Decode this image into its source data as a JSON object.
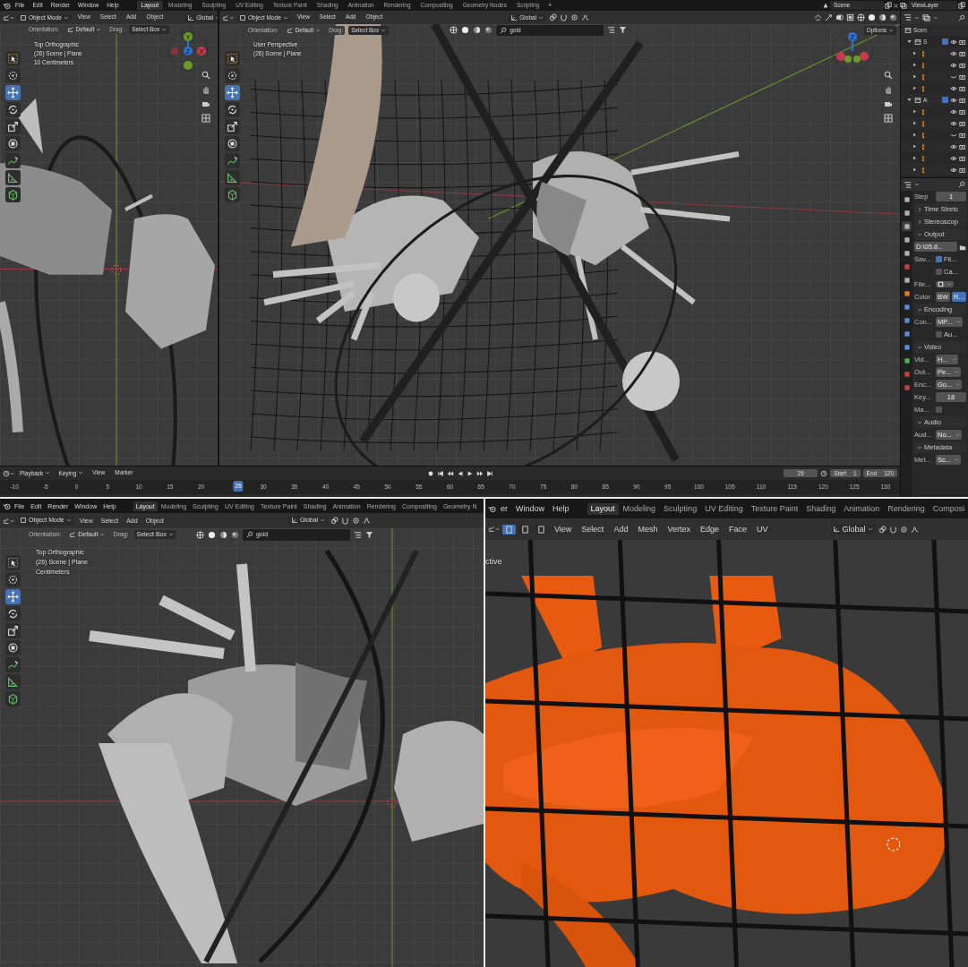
{
  "top_window": {
    "menu": [
      "File",
      "Edit",
      "Render",
      "Window",
      "Help"
    ],
    "workspaces": [
      {
        "label": "Layout",
        "selected": true
      },
      {
        "label": "Modeling",
        "selected": false
      },
      {
        "label": "Sculpting",
        "selected": false
      },
      {
        "label": "UV Editing",
        "selected": false
      },
      {
        "label": "Texture Paint",
        "selected": false
      },
      {
        "label": "Shading",
        "selected": false
      },
      {
        "label": "Animation",
        "selected": false
      },
      {
        "label": "Rendering",
        "selected": false
      },
      {
        "label": "Compositing",
        "selected": false
      },
      {
        "label": "Geometry Nodes",
        "selected": false
      },
      {
        "label": "Scripting",
        "selected": false
      }
    ],
    "add_workspace": "+",
    "scene": "Scene",
    "view_layer": "ViewLayer",
    "viewports": [
      {
        "kind": "top",
        "mode": "Object Mode",
        "menus": [
          "View",
          "Select",
          "Add",
          "Object"
        ],
        "transform": "Global",
        "orientation_label": "Orientation:",
        "orientation": "Default",
        "drag_label": "Drag:",
        "drag": "Select Box",
        "info": [
          "Top Orthographic",
          "(26) Scene | Plane",
          "10 Centimeters"
        ],
        "gizmo": [
          {
            "label": "Y",
            "color": "#6a9a2a"
          },
          {
            "label": "Z",
            "color": "#2f6fd0"
          },
          {
            "label": "X",
            "color": "#c8384e"
          }
        ],
        "tools": [
          {
            "kind": "select",
            "selected": false
          },
          {
            "kind": "cursor",
            "selected": false
          },
          {
            "kind": "move",
            "selected": true
          },
          {
            "kind": "rotate",
            "selected": false
          },
          {
            "kind": "scale",
            "selected": false
          },
          {
            "kind": "transform",
            "selected": false
          },
          {
            "kind": "annotate",
            "selected": false
          },
          {
            "kind": "measure",
            "selected": false
          },
          {
            "kind": "add",
            "selected": false
          }
        ]
      },
      {
        "kind": "perspective",
        "mode": "Object Mode",
        "menus": [
          "View",
          "Select",
          "Add",
          "Object"
        ],
        "transform": "Global",
        "orientation_label": "Orientation:",
        "orientation": "Default",
        "drag_label": "Drag:",
        "drag": "Select Box",
        "search": "gold",
        "options": "Options",
        "info": [
          "User Perspective",
          "(26) Scene | Plane"
        ],
        "gizmo": [
          {
            "label": "Z",
            "color": "#2f6fd0"
          }
        ],
        "tools": [
          {
            "kind": "select",
            "selected": false
          },
          {
            "kind": "cursor",
            "selected": false
          },
          {
            "kind": "move",
            "selected": true
          },
          {
            "kind": "rotate",
            "selected": false
          },
          {
            "kind": "scale",
            "selected": false
          },
          {
            "kind": "transform",
            "selected": false
          },
          {
            "kind": "annotate",
            "selected": false
          },
          {
            "kind": "measure",
            "selected": false
          },
          {
            "kind": "add",
            "selected": false
          }
        ]
      }
    ],
    "outliner": {
      "root": "Scen",
      "items": [
        {
          "kind": "collection",
          "label": "S",
          "checked": true,
          "visible": true,
          "children": [
            {
              "kind": "object",
              "visible": true
            },
            {
              "kind": "object",
              "visible": true
            },
            {
              "kind": "object",
              "visible": false
            },
            {
              "kind": "object",
              "visible": true
            }
          ]
        },
        {
          "kind": "collection",
          "label": "A",
          "checked": true,
          "visible": true,
          "children": [
            {
              "kind": "object",
              "visible": true
            },
            {
              "kind": "object",
              "visible": true
            },
            {
              "kind": "object",
              "visible": false
            },
            {
              "kind": "object",
              "visible": true
            },
            {
              "kind": "object",
              "visible": true
            },
            {
              "kind": "object",
              "visible": true
            }
          ]
        }
      ]
    },
    "properties": {
      "tabs": [
        {
          "color": "#b0b0b0",
          "selected": false
        },
        {
          "color": "#b0b0b0",
          "selected": false
        },
        {
          "color": "#b0b0b0",
          "selected": true
        },
        {
          "color": "#b0b0b0",
          "selected": false
        },
        {
          "color": "#b0b0b0",
          "selected": false
        },
        {
          "color": "#c44040",
          "selected": false
        },
        {
          "color": "#b0b0b0",
          "selected": false
        },
        {
          "color": "#e07a20",
          "selected": false
        },
        {
          "color": "#5a8ad8",
          "selected": false
        },
        {
          "color": "#5a8ad8",
          "selected": false
        },
        {
          "color": "#5a8ad8",
          "selected": false
        },
        {
          "color": "#5a8ad8",
          "selected": false
        },
        {
          "color": "#4ab04a",
          "selected": false
        },
        {
          "color": "#c44040",
          "selected": false
        },
        {
          "color": "#c44040",
          "selected": false
        }
      ],
      "rows": [
        {
          "kind": "field",
          "label": "Step",
          "value": "1"
        },
        {
          "kind": "panel",
          "label": "Time Stretc",
          "expanded": false
        },
        {
          "kind": "panel",
          "label": "Stereoscop",
          "expanded": false
        },
        {
          "kind": "panel",
          "label": "Output",
          "expanded": true
        },
        {
          "kind": "path",
          "value": "D:\\05.8.."
        },
        {
          "kind": "check",
          "label": "Sav...",
          "text": "Fil...",
          "checked": true
        },
        {
          "kind": "check",
          "text": "Ca...",
          "checked": false
        },
        {
          "kind": "dropdown",
          "label": "File..."
        },
        {
          "kind": "toggle",
          "label": "Color",
          "options": [
            {
              "label": "BW",
              "selected": false
            },
            {
              "label": "R...",
              "selected": true
            }
          ]
        },
        {
          "kind": "panel",
          "label": "Encoding",
          "expanded": true
        },
        {
          "kind": "dropdown",
          "label": "Con...",
          "value": "MP..."
        },
        {
          "kind": "check",
          "text": "Au...",
          "checked": false
        },
        {
          "kind": "panel",
          "label": "Video",
          "expanded": true
        },
        {
          "kind": "dropdown",
          "label": "Vid...",
          "value": "H..."
        },
        {
          "kind": "dropdown",
          "label": "Out...",
          "value": "Pe..."
        },
        {
          "kind": "dropdown",
          "label": "Enc...",
          "value": "Go..."
        },
        {
          "kind": "field",
          "label": "Key...",
          "value": "18"
        },
        {
          "kind": "check",
          "label": "Ma...",
          "checked": false
        },
        {
          "kind": "panel",
          "label": "Audio",
          "expanded": true
        },
        {
          "kind": "dropdown",
          "label": "Aud...",
          "value": "No..."
        },
        {
          "kind": "panel",
          "label": "Metadata",
          "expanded": true
        },
        {
          "kind": "dropdown",
          "label": "Met...",
          "value": "Sc..."
        }
      ]
    },
    "timeline": {
      "menus": [
        "Playback",
        "Keying",
        "View",
        "Marker"
      ],
      "current_frame": "26",
      "start_label": "Start",
      "start": "1",
      "end_label": "End",
      "end": "120",
      "ruler": [
        "-10",
        "-5",
        "0",
        "5",
        "10",
        "15",
        "20",
        "30",
        "35",
        "40",
        "45",
        "50",
        "55",
        "60",
        "65",
        "70",
        "75",
        "80",
        "85",
        "90",
        "95",
        "100",
        "105",
        "110",
        "115",
        "120",
        "125",
        "130"
      ],
      "ruler_current": "26"
    }
  },
  "bottom_left_window": {
    "menu": [
      "File",
      "Edit",
      "Render",
      "Window",
      "Help"
    ],
    "workspaces": [
      {
        "label": "Layout",
        "selected": true
      },
      {
        "label": "Modeling",
        "selected": false
      },
      {
        "label": "Sculpting",
        "selected": false
      },
      {
        "label": "UV Editing",
        "selected": false
      },
      {
        "label": "Texture Paint",
        "selected": false
      },
      {
        "label": "Shading",
        "selected": false
      },
      {
        "label": "Animation",
        "selected": false
      },
      {
        "label": "Rendering",
        "selected": false
      },
      {
        "label": "Compositing",
        "selected": false
      },
      {
        "label": "Geometry N",
        "selected": false
      }
    ],
    "viewport": {
      "kind": "closeup",
      "mode": "Object Mode",
      "menus": [
        "View",
        "Select",
        "Add",
        "Object"
      ],
      "transform": "Global",
      "orientation_label": "Orientation:",
      "orientation": "Default",
      "drag_label": "Drag:",
      "drag": "Select Box",
      "search": "gold",
      "info": [
        "Top Orthographic",
        "(26) Scene | Plane",
        "Centimeters"
      ],
      "tools": [
        {
          "kind": "select",
          "selected": false
        },
        {
          "kind": "cursor",
          "selected": false
        },
        {
          "kind": "move",
          "selected": true
        },
        {
          "kind": "rotate",
          "selected": false
        },
        {
          "kind": "scale",
          "selected": false
        },
        {
          "kind": "transform",
          "selected": false
        },
        {
          "kind": "annotate",
          "selected": false
        },
        {
          "kind": "measure",
          "selected": false
        },
        {
          "kind": "add",
          "selected": false
        }
      ]
    }
  },
  "bottom_right_window": {
    "menu": [
      "er",
      "Window",
      "Help"
    ],
    "workspaces": [
      {
        "label": "Layout",
        "selected": true
      },
      {
        "label": "Modeling",
        "selected": false
      },
      {
        "label": "Sculpting",
        "selected": false
      },
      {
        "label": "UV Editing",
        "selected": false
      },
      {
        "label": "Texture Paint",
        "selected": false
      },
      {
        "label": "Shading",
        "selected": false
      },
      {
        "label": "Animation",
        "selected": false
      },
      {
        "label": "Rendering",
        "selected": false
      },
      {
        "label": "Composi",
        "selected": false
      }
    ],
    "viewport": {
      "kind": "edit",
      "menus": [
        "View",
        "Select",
        "Add",
        "Mesh",
        "Vertex",
        "Edge",
        "Face",
        "UV"
      ],
      "select_modes": [
        {
          "selected": true
        },
        {
          "selected": false
        },
        {
          "selected": false
        }
      ],
      "transform": "Global",
      "info": [
        "ctive"
      ]
    }
  }
}
